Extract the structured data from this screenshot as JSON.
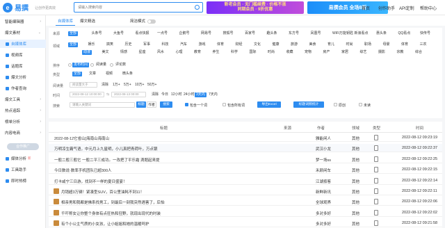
{
  "header": {
    "logo": "易撰",
    "slogan": "让创作更高效",
    "search_placeholder": "请输入搜索内容",
    "promo1": "新老会员 · 无门槛续费 · 价格不涨\n同期会员 · 9折优惠",
    "promo2": "易撰会员 全场8折",
    "nav": [
      "首页",
      "创作助手",
      "API定制",
      "帮助中心"
    ]
  },
  "sidebar": {
    "items": [
      {
        "label": "智能编辑器",
        "kind": "item"
      },
      {
        "label": "爆文素材",
        "kind": "group"
      },
      {
        "label": "自媒体库",
        "kind": "item",
        "active": true
      },
      {
        "label": "视频库",
        "kind": "item"
      },
      {
        "label": "话题库",
        "kind": "item"
      },
      {
        "label": "爆文分析",
        "kind": "item"
      },
      {
        "label": "作者查询",
        "kind": "item"
      },
      {
        "label": "爆文工具",
        "kind": "group"
      },
      {
        "label": "热点追踪",
        "kind": "group"
      },
      {
        "label": "榜单分析",
        "kind": "group"
      },
      {
        "label": "内容电商",
        "kind": "group"
      }
    ],
    "promo_button": "合作推广",
    "links": [
      "媒体分析",
      "工具助手",
      "即时热榜"
    ],
    "new_badge": "新"
  },
  "tabs": {
    "items": [
      "自媒体库",
      "爆文精选"
    ],
    "toggle_label": "简洁模式"
  },
  "filters": {
    "source_label": "来源",
    "sources": [
      "全部",
      "头条号",
      "大鱼号",
      "看点快报",
      "一点号",
      "企鹅号",
      "网易号",
      "搜狐号",
      "百家号",
      "趣头条",
      "东方号",
      "凤凰号",
      "WiFi万能钥匙",
      "新浪看点",
      "惠头条",
      "QQ看点",
      "快传号"
    ],
    "domain_label": "领域",
    "domains_row1": [
      "全部",
      "娱乐",
      "搞笑",
      "历史",
      "军事",
      "科技",
      "汽车",
      "游戏",
      "体育",
      "财经",
      "文化",
      "健康",
      "旅游",
      "美食",
      "育儿",
      "时尚",
      "职场",
      "母婴",
      "体育",
      "三农"
    ],
    "domains_row2": [
      "动漫",
      "美文",
      "情感",
      "星座",
      "风水",
      "心理",
      "教育",
      "养生",
      "科学",
      "国际",
      "时尚",
      "收藏",
      "宠物",
      "房产",
      "家居",
      "综艺",
      "摄影",
      "宗教",
      "综合"
    ],
    "sort_label": "排序",
    "sorts": [
      "发布时间",
      "阅读量",
      "评论数"
    ],
    "type_label": "类型",
    "types": [
      "全部",
      "文章",
      "视频",
      "微头条"
    ],
    "reads_label": "阅读量",
    "reads_placeholder": "阅读量大于",
    "reads_chips": [
      "清除",
      "1万+",
      "5万+",
      "10万+",
      "50万+"
    ],
    "time_label": "时间",
    "time_start": "2022-08-12 10:00:00",
    "time_end": "2022-08-13 00:00",
    "time_chips": [
      "清除",
      "今日",
      "12小时",
      "24小时",
      "3天内",
      "7天内"
    ],
    "search_label": "搜索",
    "search_placeholder": "请输入关键词",
    "btn_title": "标题",
    "btn_author": "作者",
    "btn_search": "搜索",
    "cb_ad": "包含一个词",
    "cb_not": "包含所有词",
    "btn_export": "导出Excel",
    "btn_stats": "标题词频统计",
    "cb_orig": "原创",
    "cb_unread": "未读"
  },
  "table": {
    "columns": [
      "标题",
      "来源",
      "作者",
      "领域",
      "类型",
      "时间"
    ],
    "rows": [
      {
        "title": "2022-08-12它省山]海南山海南山",
        "source": "",
        "author": "雅能闲人",
        "field": "其他",
        "time": "2022-08-12 09:23:19",
        "thumb": false
      },
      {
        "title": "万明凉生霸气语，中元月上九星明，小儿真把青荷叶，万点银",
        "source": "",
        "author": "武汉小龙",
        "field": "其他",
        "time": "2022-08-12 09:22:37",
        "thumb": false,
        "highlight": true
      },
      {
        "title": "一般二般三般它 一般二平三成功。一改把了平乐霜 滴题起来提",
        "source": "",
        "author": "梦一场ss",
        "field": "其他",
        "time": "2022-08-12 09:22:25",
        "thumb": false
      },
      {
        "title": "今日数说·数率手机团队已超300人",
        "source": "",
        "author": "禾颜闲车",
        "field": "其他",
        "time": "2022-08-12 09:22:15",
        "thumb": false
      },
      {
        "title": "打卡咸宁三日游，找到不一样的夏日盛宴！",
        "source": "",
        "author": "江湖按客",
        "field": "其他",
        "time": "2022-08-12 09:22:14",
        "thumb": false
      },
      {
        "title": "月销超3万辆！紧凑型SUV，百公里油耗不到11！",
        "source": "",
        "author": "新鲜新讯",
        "field": "其他",
        "time": "2022-08-12 09:22:11",
        "thumb": true
      },
      {
        "title": "相亲男和我都是佛系找男工，到最后一刻我突然遇害了，后怕",
        "source": "",
        "author": "全球观界",
        "field": "其他",
        "time": "2022-08-12 09:22:06",
        "thumb": true
      },
      {
        "title": "千吓称女让你整个身体有点狂热和狂野，就现出现代的时装",
        "source": "",
        "author": "多对多好",
        "field": "其他",
        "time": "2022-08-12 09:22:02",
        "thumb": true
      },
      {
        "title": "有个小公主气质的小女孩，让小姐姐和她的温暖呵护",
        "source": "",
        "author": "多对多好",
        "field": "其他",
        "time": "2022-08-12 09:21:58",
        "thumb": true
      }
    ]
  }
}
